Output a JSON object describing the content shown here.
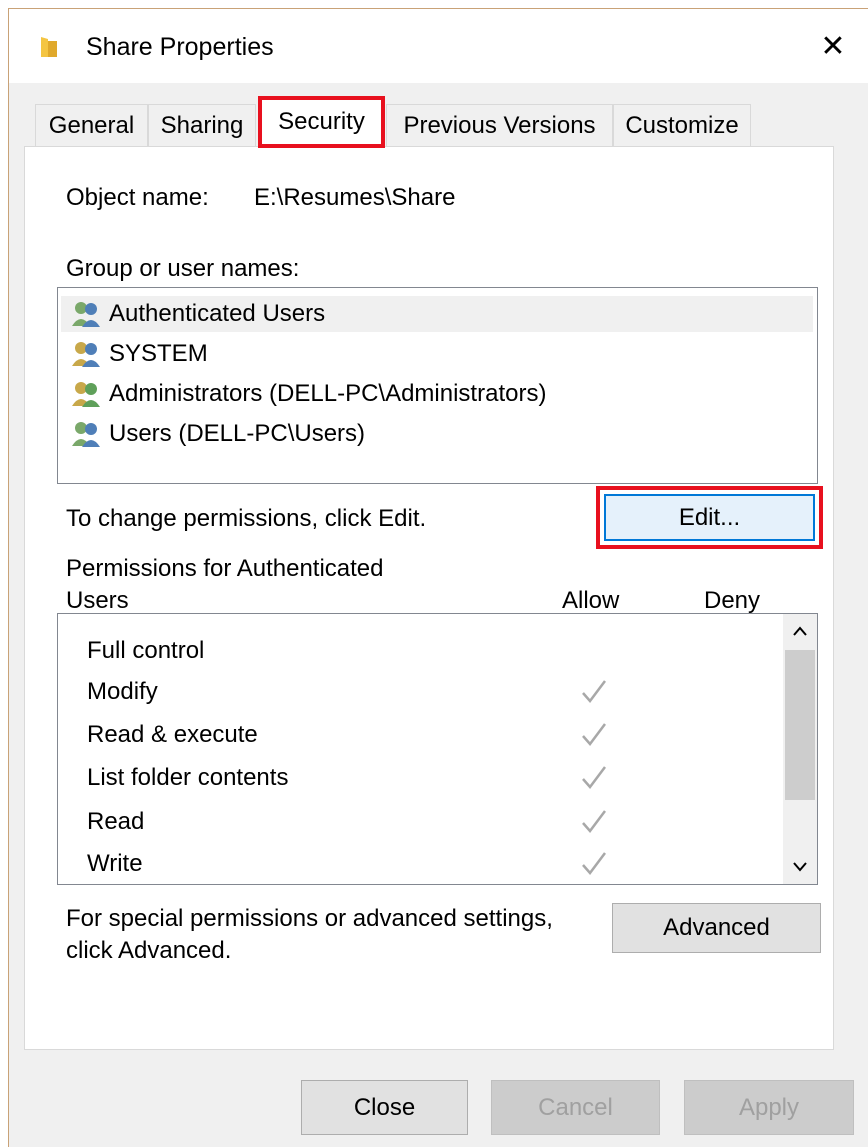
{
  "window": {
    "title": "Share Properties",
    "close_glyph": "✕"
  },
  "tabs": [
    {
      "label": "General"
    },
    {
      "label": "Sharing"
    },
    {
      "label": "Security",
      "active": true
    },
    {
      "label": "Previous Versions"
    },
    {
      "label": "Customize"
    }
  ],
  "security": {
    "object_name_label": "Object name:",
    "object_name_value": "E:\\Resumes\\Share",
    "group_label": "Group or user names:",
    "users": [
      {
        "name": "Authenticated Users",
        "selected": true
      },
      {
        "name": "SYSTEM"
      },
      {
        "name": "Administrators (DELL-PC\\Administrators)"
      },
      {
        "name": "Users (DELL-PC\\Users)"
      }
    ],
    "change_hint": "To change permissions, click Edit.",
    "edit_label": "Edit...",
    "permissions_label_line1": "Permissions for Authenticated",
    "permissions_label_line2": "Users",
    "allow_header": "Allow",
    "deny_header": "Deny",
    "permissions": [
      {
        "name": "Full control",
        "allow": false
      },
      {
        "name": "Modify",
        "allow": true
      },
      {
        "name": "Read & execute",
        "allow": true
      },
      {
        "name": "List folder contents",
        "allow": true
      },
      {
        "name": "Read",
        "allow": true
      },
      {
        "name": "Write",
        "allow": true
      }
    ],
    "advanced_hint_line1": "For special permissions or advanced settings,",
    "advanced_hint_line2": "click Advanced.",
    "advanced_label": "Advanced"
  },
  "footer": {
    "close_label": "Close",
    "cancel_label": "Cancel",
    "apply_label": "Apply"
  },
  "colors": {
    "highlight_red": "#e8101e",
    "focus_blue": "#0078d7",
    "folder_yellow": "#f4c542"
  }
}
